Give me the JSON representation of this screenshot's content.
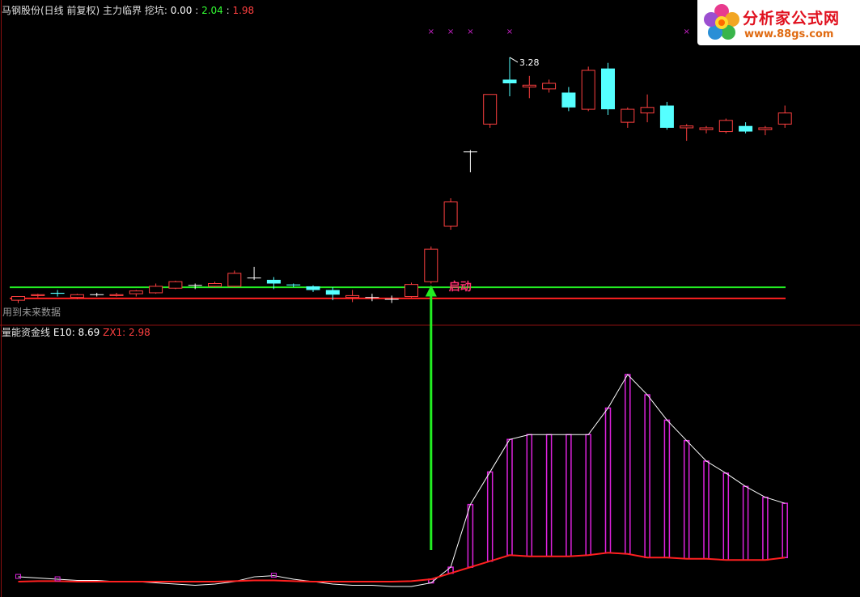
{
  "header_top": {
    "title": "马钢股份(日线 前复权) 主力临界",
    "wa_label": "挖坑: ",
    "v1": "0.00",
    "v2": "2.04",
    "v3": "1.98",
    "sep": " : ",
    "colors": {
      "v1": "#ffffff",
      "v2": "#33ff33",
      "v3": "#ff4040"
    }
  },
  "header_bottom": {
    "title": "量能资金线",
    "e10_label": "E10: 8.69",
    "zx1_label": "ZX1: 2.98",
    "colors": {
      "e10": "#ffffff",
      "zx1": "#ff4040"
    }
  },
  "note_label": "用到未来数据",
  "logo": {
    "title": "分析家公式网",
    "url": "www.88gs.com"
  },
  "chart_data": {
    "type": "candlestick",
    "price_panel": {
      "annotations": {
        "start_text": "启动",
        "high_text": "3.28"
      },
      "colors": {
        "up": "#ff4040",
        "down": "#55ffff",
        "doji": "#ffffff",
        "green_line": "#22ee22",
        "red_line": "#ff2020",
        "arrow": "#22ee22",
        "start_text": "#ff3070",
        "marker": "#cc22cc"
      },
      "lines": {
        "green": 2.04,
        "red": 1.98
      },
      "ylim": [
        1.94,
        3.38
      ],
      "candles": [
        {
          "o": 1.97,
          "h": 1.99,
          "l": 1.955,
          "c": 1.99
        },
        {
          "o": 1.995,
          "h": 2.005,
          "l": 1.985,
          "c": 2.0
        },
        {
          "o": 2.01,
          "h": 2.025,
          "l": 1.99,
          "c": 2.005
        },
        {
          "o": 1.985,
          "h": 2.005,
          "l": 1.975,
          "c": 2.0
        },
        {
          "o": 2.0,
          "h": 2.01,
          "l": 1.99,
          "c": 2.0
        },
        {
          "o": 1.995,
          "h": 2.01,
          "l": 1.99,
          "c": 2.0
        },
        {
          "o": 2.005,
          "h": 2.025,
          "l": 1.99,
          "c": 2.02
        },
        {
          "o": 2.01,
          "h": 2.06,
          "l": 2.005,
          "c": 2.045
        },
        {
          "o": 2.035,
          "h": 2.075,
          "l": 2.03,
          "c": 2.07
        },
        {
          "o": 2.05,
          "h": 2.06,
          "l": 2.03,
          "c": 2.05
        },
        {
          "o": 2.045,
          "h": 2.07,
          "l": 2.04,
          "c": 2.06
        },
        {
          "o": 2.045,
          "h": 2.13,
          "l": 2.04,
          "c": 2.115
        },
        {
          "o": 2.09,
          "h": 2.15,
          "l": 2.08,
          "c": 2.09
        },
        {
          "o": 2.08,
          "h": 2.095,
          "l": 2.03,
          "c": 2.06
        },
        {
          "o": 2.055,
          "h": 2.06,
          "l": 2.04,
          "c": 2.05
        },
        {
          "o": 2.045,
          "h": 2.05,
          "l": 2.015,
          "c": 2.025
        },
        {
          "o": 2.025,
          "h": 2.04,
          "l": 1.97,
          "c": 2.0
        },
        {
          "o": 1.985,
          "h": 2.025,
          "l": 1.96,
          "c": 1.995
        },
        {
          "o": 1.985,
          "h": 2.005,
          "l": 1.965,
          "c": 1.985
        },
        {
          "o": 1.975,
          "h": 1.995,
          "l": 1.955,
          "c": 1.975
        },
        {
          "o": 1.99,
          "h": 2.065,
          "l": 1.985,
          "c": 2.055
        },
        {
          "o": 2.07,
          "h": 2.26,
          "l": 2.06,
          "c": 2.245
        },
        {
          "o": 2.37,
          "h": 2.52,
          "l": 2.35,
          "c": 2.5
        },
        {
          "o": 2.77,
          "h": 2.78,
          "l": 2.66,
          "c": 2.77
        },
        {
          "o": 2.92,
          "h": 3.08,
          "l": 2.9,
          "c": 3.08
        },
        {
          "o": 3.16,
          "h": 3.28,
          "l": 3.07,
          "c": 3.14
        },
        {
          "o": 3.12,
          "h": 3.18,
          "l": 3.06,
          "c": 3.13
        },
        {
          "o": 3.11,
          "h": 3.16,
          "l": 3.09,
          "c": 3.14
        },
        {
          "o": 3.09,
          "h": 3.12,
          "l": 2.99,
          "c": 3.01
        },
        {
          "o": 3.0,
          "h": 3.23,
          "l": 2.99,
          "c": 3.21
        },
        {
          "o": 3.22,
          "h": 3.25,
          "l": 2.97,
          "c": 3.0
        },
        {
          "o": 2.93,
          "h": 3.01,
          "l": 2.9,
          "c": 3.0
        },
        {
          "o": 2.98,
          "h": 3.08,
          "l": 2.93,
          "c": 3.01
        },
        {
          "o": 3.02,
          "h": 3.04,
          "l": 2.89,
          "c": 2.9
        },
        {
          "o": 2.9,
          "h": 2.92,
          "l": 2.83,
          "c": 2.91
        },
        {
          "o": 2.89,
          "h": 2.91,
          "l": 2.87,
          "c": 2.9
        },
        {
          "o": 2.88,
          "h": 2.95,
          "l": 2.87,
          "c": 2.94
        },
        {
          "o": 2.91,
          "h": 2.93,
          "l": 2.87,
          "c": 2.88
        },
        {
          "o": 2.89,
          "h": 2.91,
          "l": 2.86,
          "c": 2.9
        },
        {
          "o": 2.92,
          "h": 3.02,
          "l": 2.9,
          "c": 2.98
        }
      ],
      "x_marker_indices": [
        21,
        22,
        23,
        25,
        34
      ],
      "start_index": 21,
      "high_index": 25
    },
    "indicator_panel": {
      "ylim": [
        0,
        10
      ],
      "colors": {
        "e10": "#ffffff",
        "zx1": "#ff2020",
        "bars": "#dd22dd"
      },
      "e10": [
        0.3,
        0.25,
        0.2,
        0.15,
        0.15,
        0.1,
        0.1,
        0.05,
        0.0,
        -0.05,
        0.0,
        0.1,
        0.3,
        0.35,
        0.2,
        0.1,
        0.0,
        -0.05,
        -0.05,
        -0.1,
        -0.1,
        0.05,
        0.7,
        3.3,
        4.65,
        6.0,
        6.2,
        6.2,
        6.2,
        6.2,
        7.3,
        8.69,
        7.85,
        6.8,
        5.95,
        5.1,
        4.6,
        4.05,
        3.6,
        3.35
      ],
      "zx1": [
        0.1,
        0.12,
        0.12,
        0.1,
        0.1,
        0.1,
        0.1,
        0.1,
        0.1,
        0.1,
        0.1,
        0.12,
        0.15,
        0.15,
        0.12,
        0.1,
        0.1,
        0.1,
        0.1,
        0.1,
        0.12,
        0.2,
        0.45,
        0.7,
        0.95,
        1.2,
        1.15,
        1.15,
        1.15,
        1.2,
        1.3,
        1.25,
        1.1,
        1.1,
        1.05,
        1.05,
        1.0,
        1.0,
        1.0,
        1.1
      ],
      "bar_start_index": 21
    }
  }
}
